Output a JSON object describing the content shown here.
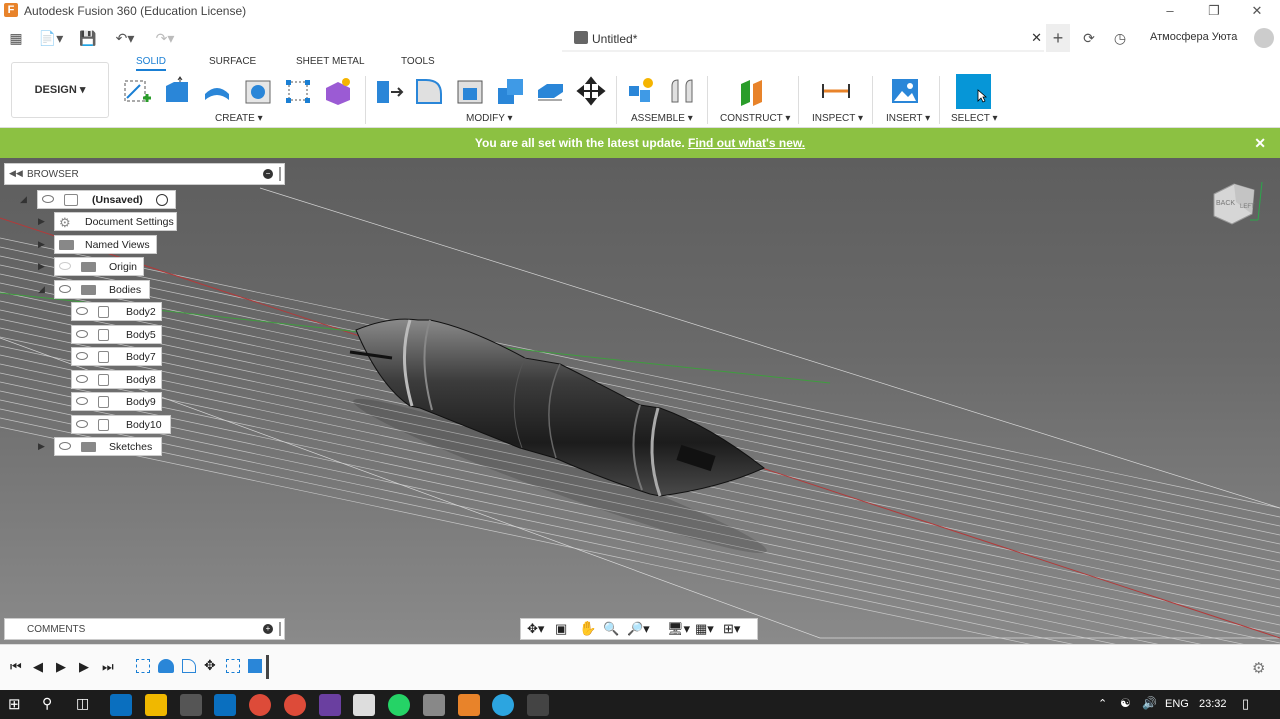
{
  "window": {
    "title": "Autodesk Fusion 360 (Education License)",
    "user": "Атмосфера Уюта"
  },
  "document": {
    "tab_name": "Untitled*"
  },
  "ribbon": {
    "workspace": "DESIGN ▾",
    "tabs": [
      "SOLID",
      "SURFACE",
      "SHEET METAL",
      "TOOLS"
    ],
    "groups": [
      "CREATE ▾",
      "MODIFY ▾",
      "ASSEMBLE ▾",
      "CONSTRUCT ▾",
      "INSPECT ▾",
      "INSERT ▾",
      "SELECT ▾"
    ]
  },
  "banner": {
    "text": "You are all set with the latest update.",
    "link": "Find out what's new."
  },
  "browser": {
    "title": "BROWSER",
    "root": "(Unsaved)",
    "items": [
      "Document Settings",
      "Named Views",
      "Origin",
      "Bodies",
      "Sketches"
    ],
    "bodies": [
      "Body2",
      "Body5",
      "Body7",
      "Body8",
      "Body9",
      "Body10"
    ]
  },
  "comments": {
    "title": "COMMENTS"
  },
  "viewcube": {
    "face": "BACK",
    "side": "LEFT"
  },
  "taskbar": {
    "lang": "ENG",
    "time": "23:32"
  },
  "colors": {
    "banner": "#8cc142",
    "accent": "#1a7fd4",
    "select_button": "#0696d7"
  }
}
